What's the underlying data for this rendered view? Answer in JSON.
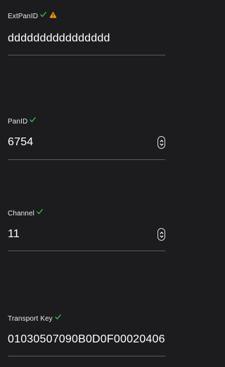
{
  "fields": {
    "extpanid": {
      "label": "ExtPanID",
      "value": "dddddddddddddddd"
    },
    "panid": {
      "label": "PanID",
      "value": "6754"
    },
    "channel": {
      "label": "Channel",
      "value": "11"
    },
    "transport_key": {
      "label": "Transport Key",
      "value": "01030507090B0D0F00020406"
    }
  },
  "colors": {
    "background": "#1c1c1e",
    "check": "#34c759",
    "warning": "#ff9f0a",
    "divider": "#5a5a5e"
  },
  "icons": {
    "valid": "check-icon",
    "warning": "warning-icon",
    "stepper": "stepper-icon"
  }
}
